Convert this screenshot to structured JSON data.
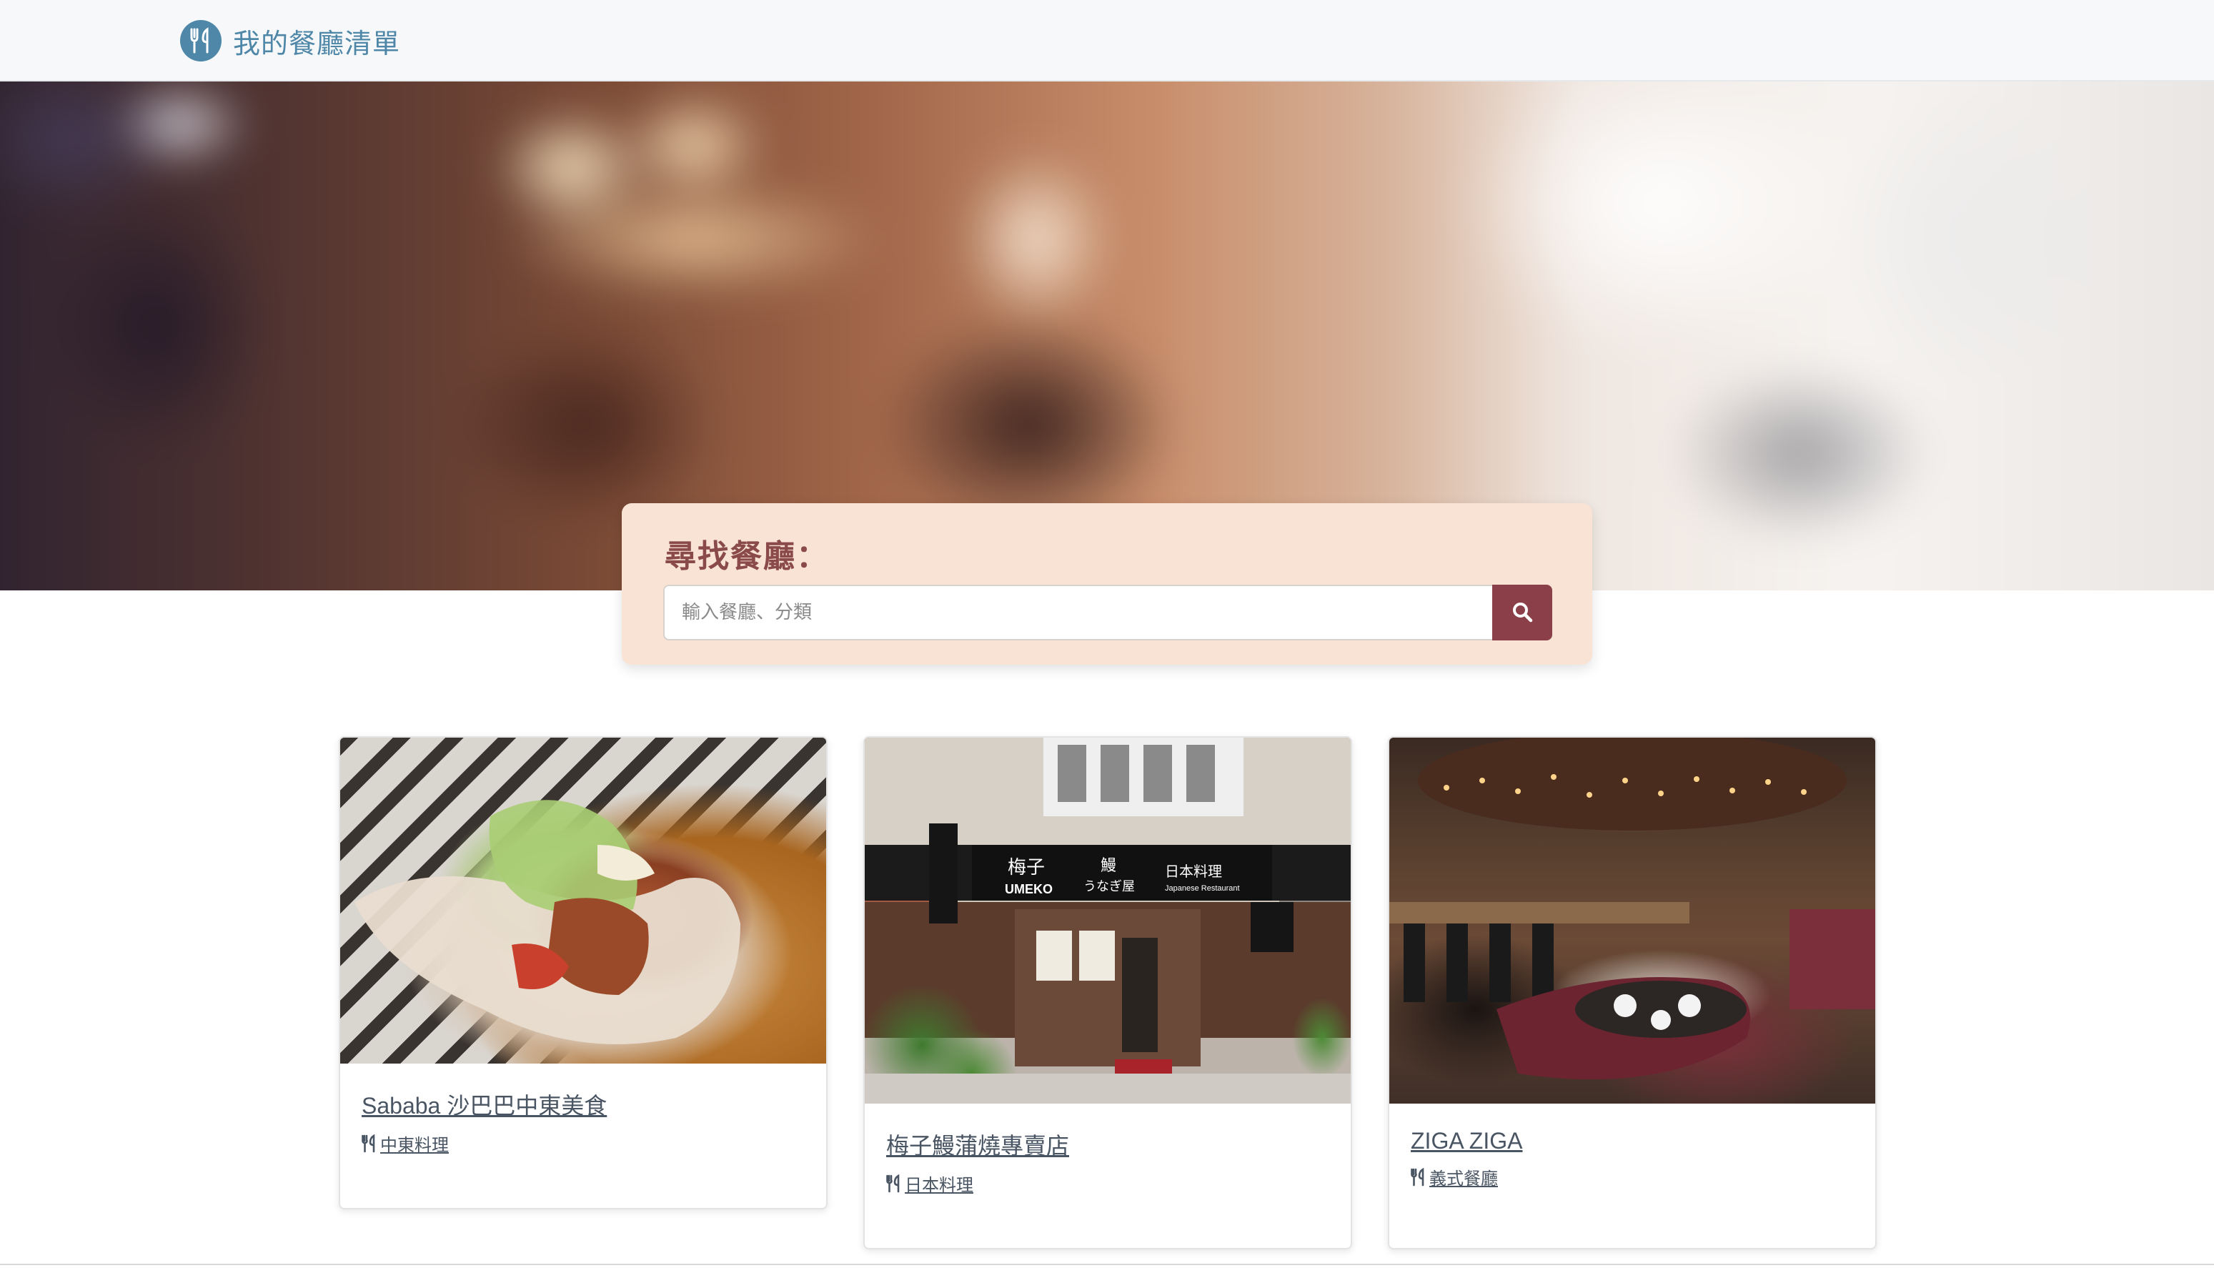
{
  "navbar": {
    "brand_name": "我的餐廳清單",
    "brand_icon": "utensils-icon"
  },
  "search": {
    "title": "尋找餐廳：",
    "placeholder": "輸入餐廳、分類",
    "value": "",
    "button_icon": "search-icon"
  },
  "restaurants": [
    {
      "name": "Sababa 沙巴巴中東美食",
      "category": "中東料理",
      "category_icon": "utensils-icon",
      "image": "pita-sandwich-photo"
    },
    {
      "name": "梅子鰻蒲燒專賣店",
      "category": "日本料理",
      "category_icon": "utensils-icon",
      "image": "umeko-storefront-photo"
    },
    {
      "name": "ZIGA ZIGA",
      "category": "義式餐廳",
      "category_icon": "utensils-icon",
      "image": "restaurant-interior-photo"
    }
  ],
  "store_sign": {
    "main": "梅子",
    "latin": "UMEKO",
    "eel": "鰻",
    "kana": "うなぎ屋",
    "japanese_cuisine": "日本料理",
    "japanese_restaurant": "Japanese Restaurant"
  },
  "colors": {
    "brand": "#4f87a8",
    "search_title": "#8b4a4a",
    "search_button": "#8b4049",
    "search_panel": "#f8e3d4",
    "link_text": "#4a5563"
  }
}
